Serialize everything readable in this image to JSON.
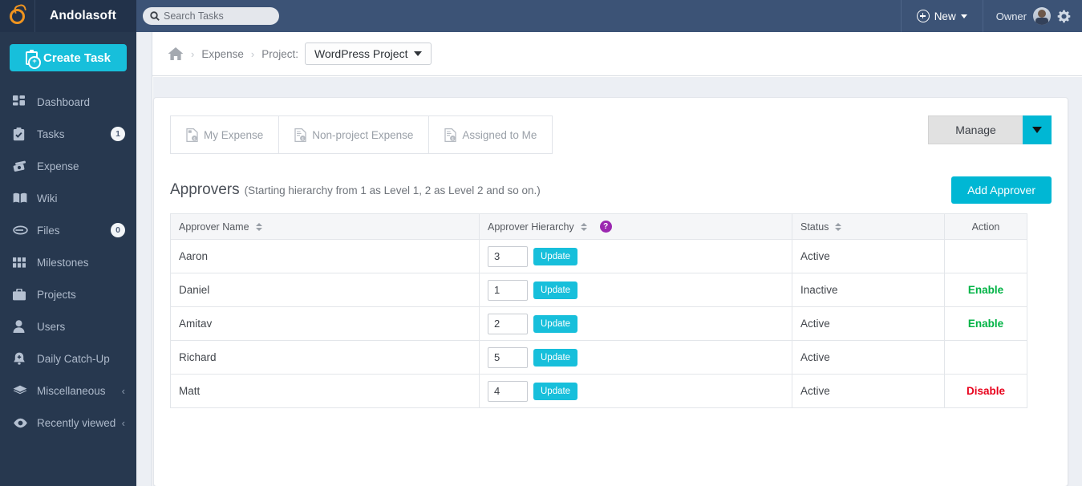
{
  "brand": {
    "name": "Andolasoft",
    "logo_icon": "ring-logo-icon"
  },
  "sidebar": {
    "create_task_label": "Create Task",
    "items": [
      {
        "label": "Dashboard",
        "icon": "grid-icon",
        "badge": null,
        "chevron": false
      },
      {
        "label": "Tasks",
        "icon": "clipboard-check-icon",
        "badge": "1",
        "chevron": false
      },
      {
        "label": "Expense",
        "icon": "money-icon",
        "badge": null,
        "chevron": false
      },
      {
        "label": "Wiki",
        "icon": "book-icon",
        "badge": null,
        "chevron": false
      },
      {
        "label": "Files",
        "icon": "paperclip-icon",
        "badge": "0",
        "chevron": false
      },
      {
        "label": "Milestones",
        "icon": "blocks-icon",
        "badge": null,
        "chevron": false
      },
      {
        "label": "Projects",
        "icon": "briefcase-icon",
        "badge": null,
        "chevron": false
      },
      {
        "label": "Users",
        "icon": "user-icon",
        "badge": null,
        "chevron": false
      },
      {
        "label": "Daily Catch-Up",
        "icon": "bell-plus-icon",
        "badge": null,
        "chevron": false
      },
      {
        "label": "Miscellaneous",
        "icon": "layers-icon",
        "badge": null,
        "chevron": true
      },
      {
        "label": "Recently viewed",
        "icon": "eye-icon",
        "badge": null,
        "chevron": true
      }
    ],
    "chevron_glyph": "‹"
  },
  "topbar": {
    "search_placeholder": "Search Tasks",
    "search_value": "",
    "new_label": "New",
    "owner_label": "Owner"
  },
  "breadcrumb": {
    "home_icon": "home-icon",
    "separator": "›",
    "expense_label": "Expense",
    "project_label": "Project:",
    "project_value": "WordPress Project"
  },
  "tabs": [
    {
      "label": "My Expense",
      "icon": "expense-doc-icon",
      "active": true
    },
    {
      "label": "Non-project Expense",
      "icon": "document-dollar-icon",
      "active": false
    },
    {
      "label": "Assigned to Me",
      "icon": "document-dollar-icon",
      "active": false
    }
  ],
  "manage": {
    "label": "Manage",
    "caret_icon": "caret-down-icon"
  },
  "approvers": {
    "title": "Approvers",
    "note": "(Starting hierarchy from 1 as Level 1, 2 as Level 2 and so on.)",
    "add_button_label": "Add Approver",
    "help_icon_glyph": "?",
    "columns": [
      {
        "label": "Approver Name",
        "sortable": true,
        "help": false
      },
      {
        "label": "Approver Hierarchy",
        "sortable": true,
        "help": true
      },
      {
        "label": "Status",
        "sortable": true,
        "help": false
      },
      {
        "label": "Action",
        "sortable": false,
        "help": false
      }
    ],
    "update_label": "Update",
    "rows": [
      {
        "name": "Aaron",
        "hierarchy": "3",
        "status": "Active",
        "action": "",
        "action_type": "none"
      },
      {
        "name": "Daniel",
        "hierarchy": "1",
        "status": "Inactive",
        "action": "Enable",
        "action_type": "enable"
      },
      {
        "name": "Amitav",
        "hierarchy": "2",
        "status": "Active",
        "action": "Enable",
        "action_type": "enable"
      },
      {
        "name": "Richard",
        "hierarchy": "5",
        "status": "Active",
        "action": "",
        "action_type": "none"
      },
      {
        "name": "Matt",
        "hierarchy": "4",
        "status": "Active",
        "action": "Disable",
        "action_type": "disable"
      }
    ]
  },
  "colors": {
    "sidebar_bg": "#27384f",
    "topbar_bg": "#3c5376",
    "accent_cyan": "#00b7d4",
    "create_cyan": "#17bfdb",
    "enable_green": "#00b345",
    "disable_red": "#e8001b",
    "help_purple": "#9b27b0",
    "logo_orange": "#f0941f"
  }
}
